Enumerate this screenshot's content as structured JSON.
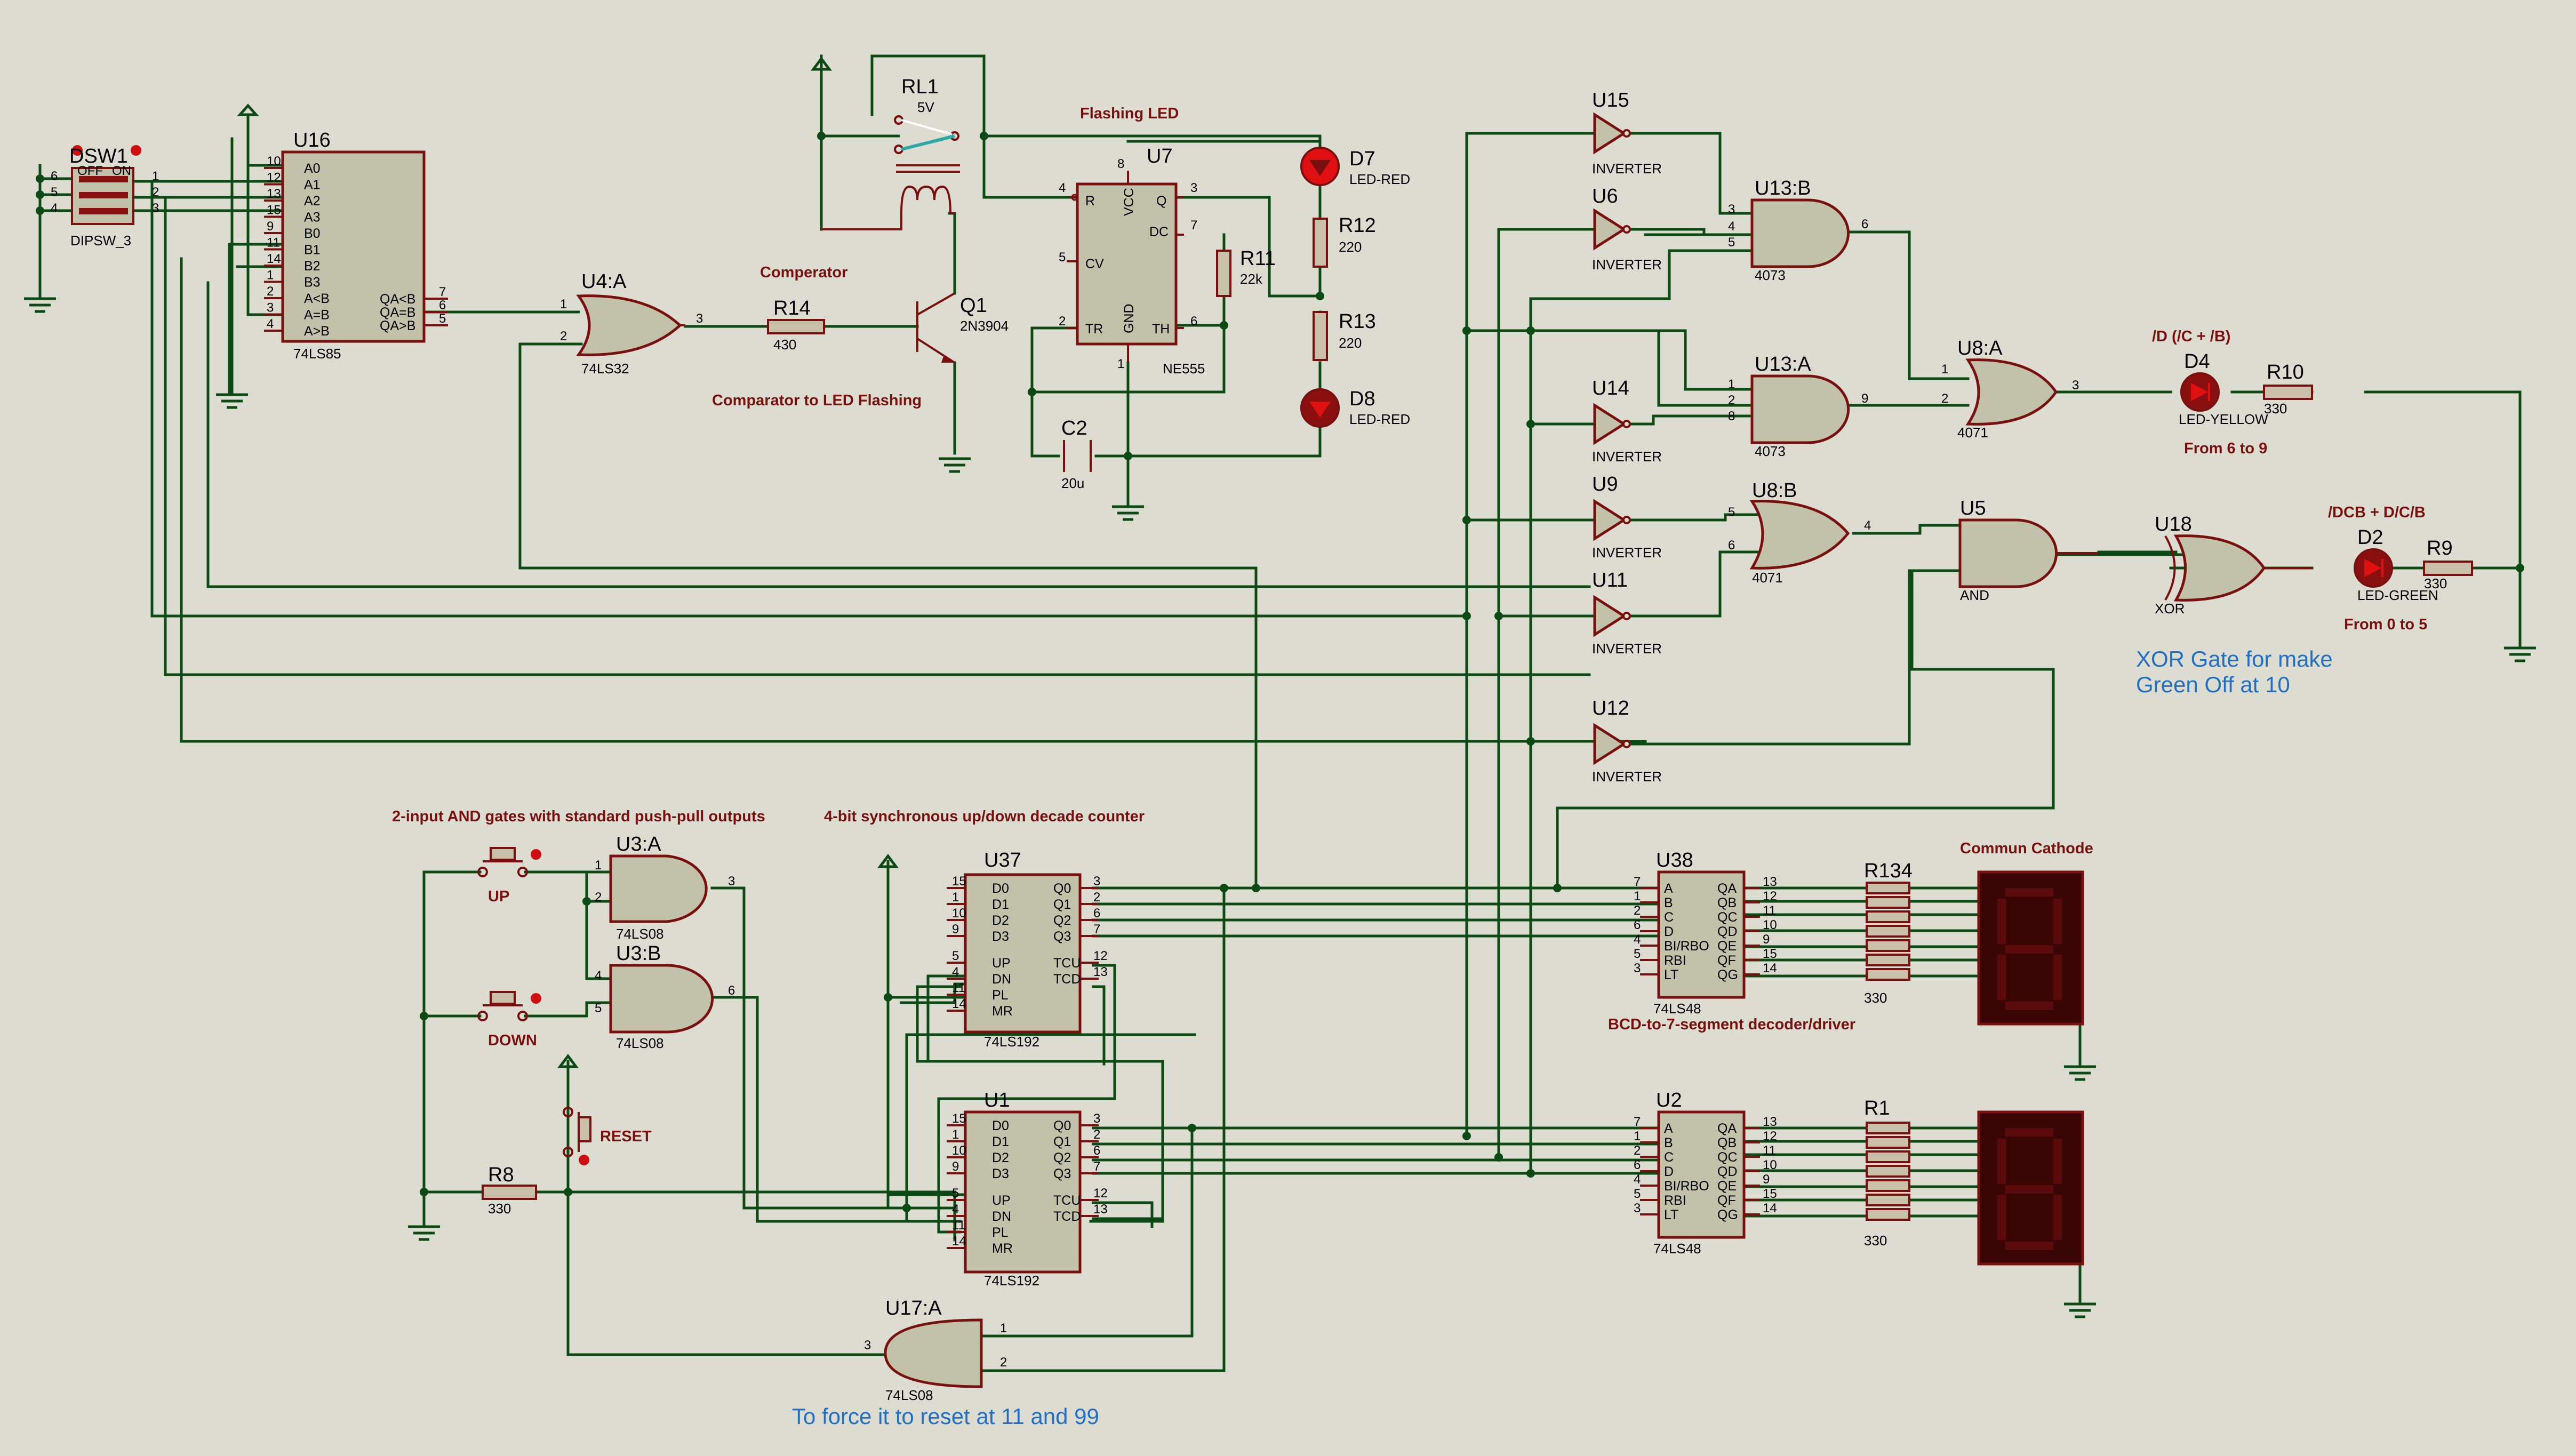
{
  "components": {
    "DSW1": {
      "ref": "DSW1",
      "value": "DIPSW_3",
      "off": "OFF",
      "on": "ON",
      "pins": [
        "6",
        "5",
        "4",
        "1",
        "2",
        "3"
      ]
    },
    "U16": {
      "ref": "U16",
      "value": "74LS85",
      "left_pins": [
        {
          "n": "10",
          "l": "A0"
        },
        {
          "n": "12",
          "l": "A1"
        },
        {
          "n": "13",
          "l": "A2"
        },
        {
          "n": "15",
          "l": "A3"
        },
        {
          "n": "9",
          "l": "B0"
        },
        {
          "n": "11",
          "l": "B1"
        },
        {
          "n": "14",
          "l": "B2"
        },
        {
          "n": "1",
          "l": "B3"
        },
        {
          "n": "2",
          "l": "A<B"
        },
        {
          "n": "3",
          "l": "A=B"
        },
        {
          "n": "4",
          "l": "A>B"
        }
      ],
      "right_pins": [
        {
          "n": "7",
          "l": "QA<B"
        },
        {
          "n": "6",
          "l": "QA=B"
        },
        {
          "n": "5",
          "l": "QA>B"
        }
      ]
    },
    "U4A": {
      "ref": "U4:A",
      "value": "74LS32",
      "in1": "1",
      "in2": "2",
      "out": "3"
    },
    "R14": {
      "ref": "R14",
      "value": "430"
    },
    "Q1": {
      "ref": "Q1",
      "value": "2N3904"
    },
    "RL1": {
      "ref": "RL1",
      "value": "5V"
    },
    "U7": {
      "ref": "U7",
      "value": "NE555",
      "pins": {
        "R": "R",
        "Q": "Q",
        "DC": "DC",
        "CV": "CV",
        "TR": "TR",
        "TH": "TH",
        "VCC": "VCC",
        "GND": "GND"
      },
      "nums": {
        "r": "4",
        "q": "3",
        "dc": "7",
        "cv": "5",
        "tr": "2",
        "th": "6",
        "vcc": "8",
        "gnd": "1"
      }
    },
    "R11": {
      "ref": "R11",
      "value": "22k"
    },
    "C2": {
      "ref": "C2",
      "value": "20u"
    },
    "D7": {
      "ref": "D7",
      "value": "LED-RED"
    },
    "R12": {
      "ref": "R12",
      "value": "220"
    },
    "R13": {
      "ref": "R13",
      "value": "220"
    },
    "D8": {
      "ref": "D8",
      "value": "LED-RED"
    },
    "U15": {
      "ref": "U15",
      "value": "INVERTER"
    },
    "U6": {
      "ref": "U6",
      "value": "INVERTER"
    },
    "U14": {
      "ref": "U14",
      "value": "INVERTER"
    },
    "U9": {
      "ref": "U9",
      "value": "INVERTER"
    },
    "U11": {
      "ref": "U11",
      "value": "INVERTER"
    },
    "U12": {
      "ref": "U12",
      "value": "INVERTER"
    },
    "U13B": {
      "ref": "U13:B",
      "value": "4073",
      "pins": [
        "3",
        "4",
        "5",
        "6"
      ]
    },
    "U13A": {
      "ref": "U13:A",
      "value": "4073",
      "pins": [
        "1",
        "2",
        "8",
        "9"
      ]
    },
    "U8A": {
      "ref": "U8:A",
      "value": "4071",
      "pins": [
        "1",
        "2",
        "3"
      ]
    },
    "U8B": {
      "ref": "U8:B",
      "value": "4071",
      "pins": [
        "5",
        "6",
        "4"
      ]
    },
    "U5": {
      "ref": "U5",
      "value": "AND"
    },
    "U18": {
      "ref": "U18",
      "value": "XOR"
    },
    "D4": {
      "ref": "D4",
      "value": "LED-YELLOW"
    },
    "R10": {
      "ref": "R10",
      "value": "330"
    },
    "D2": {
      "ref": "D2",
      "value": "LED-GREEN"
    },
    "R9": {
      "ref": "R9",
      "value": "330"
    },
    "U3A": {
      "ref": "U3:A",
      "value": "74LS08",
      "pins": [
        "1",
        "2",
        "3"
      ]
    },
    "U3B": {
      "ref": "U3:B",
      "value": "74LS08",
      "pins": [
        "4",
        "5",
        "6"
      ]
    },
    "UP": {
      "label": "UP"
    },
    "DOWN": {
      "label": "DOWN"
    },
    "RESET": {
      "label": "RESET"
    },
    "R8": {
      "ref": "R8",
      "value": "330"
    },
    "U37": {
      "ref": "U37",
      "value": "74LS192"
    },
    "U1": {
      "ref": "U1",
      "value": "74LS192"
    },
    "U38": {
      "ref": "U38",
      "value": "74LS48"
    },
    "U2": {
      "ref": "U2",
      "value": "74LS48"
    },
    "R134": {
      "ref": "R134",
      "value": "330"
    },
    "R1": {
      "ref": "R1",
      "value": "330"
    },
    "U17A": {
      "ref": "U17:A",
      "value": "74LS08",
      "pins": [
        "1",
        "2",
        "3"
      ]
    }
  },
  "counter_pins": {
    "left": [
      {
        "n": "15",
        "l": "D0"
      },
      {
        "n": "1",
        "l": "D1"
      },
      {
        "n": "10",
        "l": "D2"
      },
      {
        "n": "9",
        "l": "D3"
      },
      {
        "n": "5",
        "l": "UP"
      },
      {
        "n": "4",
        "l": "DN"
      },
      {
        "n": "11",
        "l": "PL"
      },
      {
        "n": "14",
        "l": "MR"
      }
    ],
    "right": [
      {
        "n": "3",
        "l": "Q0"
      },
      {
        "n": "2",
        "l": "Q1"
      },
      {
        "n": "6",
        "l": "Q2"
      },
      {
        "n": "7",
        "l": "Q3"
      },
      {
        "n": "12",
        "l": "TCU"
      },
      {
        "n": "13",
        "l": "TCD"
      }
    ]
  },
  "decoder_pins": {
    "left": [
      {
        "n": "7",
        "l": "A"
      },
      {
        "n": "1",
        "l": "B"
      },
      {
        "n": "2",
        "l": "C"
      },
      {
        "n": "6",
        "l": "D"
      },
      {
        "n": "4",
        "l": "BI/RBO"
      },
      {
        "n": "5",
        "l": "RBI"
      },
      {
        "n": "3",
        "l": "LT"
      }
    ],
    "right": [
      {
        "n": "13",
        "l": "QA"
      },
      {
        "n": "12",
        "l": "QB"
      },
      {
        "n": "11",
        "l": "QC"
      },
      {
        "n": "10",
        "l": "QD"
      },
      {
        "n": "9",
        "l": "QE"
      },
      {
        "n": "15",
        "l": "QF"
      },
      {
        "n": "14",
        "l": "QG"
      }
    ]
  },
  "notes": {
    "flashing_led": "Flashing LED",
    "comperator": "Comperator",
    "comp_to_led": "Comparator to LED Flashing",
    "d4_formula": "/D (/C + /B)",
    "d4_range": "From 6  to 9",
    "d2_formula": "/DCB + D/C/B",
    "d2_range": "From 0 to 5",
    "xor_note_1": "XOR Gate for make",
    "xor_note_2": "Green Off at 10",
    "and_gates": "2-input AND gates with standard push-pull outputs",
    "counter": "4-bit synchronous up/down decade counter",
    "common_cathode": "Commun Cathode",
    "decoder": "BCD-to-7-segment decoder/driver",
    "reset_note": "To force it to reset at 11 and 99"
  },
  "colors": {
    "wire": "#0b4a14",
    "part": "#7a0f10",
    "body": "#c2c2aa",
    "background": "#dcdcd0",
    "note_blue": "#1f6fc6",
    "led_red": "#e01010"
  }
}
